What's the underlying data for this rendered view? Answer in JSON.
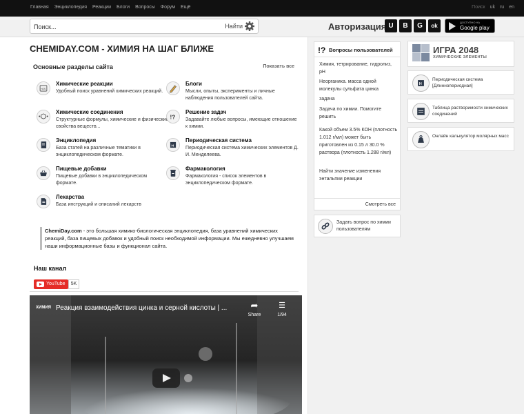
{
  "topnav": {
    "items": [
      "Главная",
      "Энциклопедия",
      "Реакции",
      "Блоги",
      "Вопросы",
      "Форум",
      "Ещё"
    ]
  },
  "langs": [
    "Поиск",
    "uk",
    "ru",
    "en"
  ],
  "search": {
    "placeholder": "Поиск...",
    "button": "Найти"
  },
  "auth": {
    "label": "Авторизация:",
    "providers": [
      "U",
      "B",
      "G",
      "ok"
    ]
  },
  "gplay": {
    "line1": "ДОСТУПНО НА",
    "line2": "Google play"
  },
  "site_title": "CHEMIDAY.COM - ХИМИЯ НА ШАГ БЛИЖЕ",
  "sections": {
    "heading": "Основные разделы сайта",
    "show_all": "Показать все",
    "items": [
      {
        "title": "Химические реакции",
        "desc": "Удобный поиск уравнений химических реакций.",
        "icon": "flask-h2s-icon"
      },
      {
        "title": "Блоги",
        "desc": "Мысли, опыты, эксперименты и личные наблюдения пользователей сайта.",
        "icon": "pen-icon"
      },
      {
        "title": "Химические соединения",
        "desc": "Структурные формулы, химические и физические свойства веществ...",
        "icon": "molecule-icon"
      },
      {
        "title": "Решение задач",
        "desc": "Задавайте любые вопросы, имеющие отношение к химии.",
        "icon": "question-icon"
      },
      {
        "title": "Энциклопедия",
        "desc": "База статей на различные тематики в энциклопедическом формате.",
        "icon": "book-icon"
      },
      {
        "title": "Периодическая система",
        "desc": "Периодическая система химических элементов Д. И. Менделеева.",
        "icon": "periodic-table-icon"
      },
      {
        "title": "Пищевые добавки",
        "desc": "Пищевые добавки в энциклопедическом формате.",
        "icon": "basket-icon"
      },
      {
        "title": "Фармакология",
        "desc": "Фармакология - список элементов в энциклопедическом формате.",
        "icon": "pill-bottle-icon"
      },
      {
        "title": "Лекарства",
        "desc": "База инструкций и описаний лекарств",
        "icon": "document-icon"
      }
    ]
  },
  "about": {
    "brand": "ChemiDay.com",
    "text": " - это большая химико-биологическая энциклопедия, база уравнений химических реакций, база пищевых добавок и удобный поиск необходимой информации. Мы ежедневно улучшаем наши информационные базы и функционал сайта."
  },
  "channel": {
    "heading": "Наш канал",
    "youtube_label": "YouTube",
    "subscribers": "5K"
  },
  "video": {
    "logo": "ХИМИЯ",
    "title": "Реакция взаимодействия цинка и серной кислоты | ...",
    "share": "Share",
    "playlist": "1/94"
  },
  "questions": {
    "heading": "Вопросы пользователей",
    "items": [
      "Химия, тетрирование, гидролиз, pH",
      "Неорганика. масса одной молекулы сульфата цинка",
      "задача",
      "Задача по химии. Помогите решить",
      "Какой объем 3.5% КОН (плотность 1.012 г/мл) может быть приготовлен из 0.15 л 30.0 % раствора (плотность 1.288 г/мл)",
      "Найти значение изменения энтальпии реакции"
    ],
    "see_all": "Смотреть все",
    "ask": "Задать вопрос по химии пользователям"
  },
  "tiles": {
    "game_title": "ИГРА 2048",
    "game_sub": "ХИМИЧЕСКИЕ ЭЛЕМЕНТЫ",
    "game_cells": [
      "Be",
      "Ti",
      "Be",
      "B"
    ],
    "periodic": "Периодическая система [Длиннопериодная]",
    "solubility": "Таблица растворимости химических соединений",
    "molar": "Онлайн калькулятор молярных масс"
  }
}
